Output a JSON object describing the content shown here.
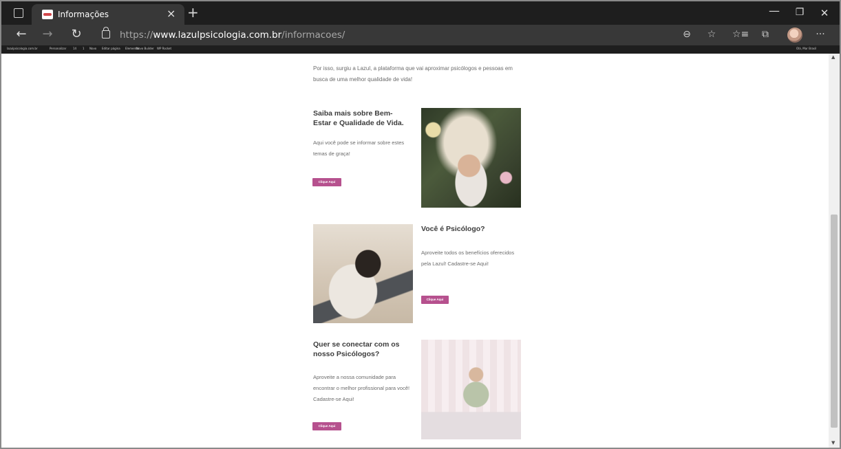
{
  "browser": {
    "tab": {
      "title": "Informações",
      "close_glyph": "×"
    },
    "new_tab_glyph": "+",
    "window": {
      "minimize_glyph": "—",
      "maximize_glyph": "❐",
      "close_glyph": "✕"
    },
    "nav": {
      "back_glyph": "←",
      "forward_glyph": "→",
      "reload_glyph": "↻"
    },
    "url": {
      "scheme": "https://",
      "host": "www.lazulpsicologia.com.br",
      "path": "/informacoes/"
    },
    "toolbar_icons": {
      "zoom": "⊖",
      "add_favorite": "☆",
      "favorites": "☆≡",
      "collections": "⧉",
      "more": "···"
    },
    "favorites_bar": [
      "lazulpsicologia.com.br",
      "Personalizar",
      "14",
      "1",
      "Novo",
      "Editar página",
      "Elementor",
      "Novo Builder",
      "WP Rocket",
      "Olá, Mar Brasil"
    ]
  },
  "page": {
    "intro": "Por isso, surgiu a Lazul, a plataforma que vai aproximar psicólogos e pessoas em busca de uma melhor qualidade de vida!",
    "sections": [
      {
        "heading": "Saiba mais sobre Bem-Estar e Qualidade de Vida.",
        "text": "Aqui você pode se informar sobre estes temas de graça!",
        "button": "Clique Aqui"
      },
      {
        "heading": "Você é Psicólogo?",
        "text": "Aproveite todos os benefícios oferecidos pela Lazul!  Cadastre-se Aqui!",
        "button": "Clique Aqui"
      },
      {
        "heading": "Quer se conectar com os nosso Psicólogos?",
        "text": "Aproveite  a nossa comunidade para encontrar o melhor profissional para você! Cadastre-se Aqui!",
        "button": "Clique Aqui"
      }
    ]
  },
  "scrollbar": {
    "up_glyph": "▲",
    "down_glyph": "▼",
    "position_fraction": 0.55
  },
  "colors": {
    "accent_button": "#b6518e",
    "browser_dark": "#1e1e1e",
    "browser_toolbar": "#383838"
  }
}
